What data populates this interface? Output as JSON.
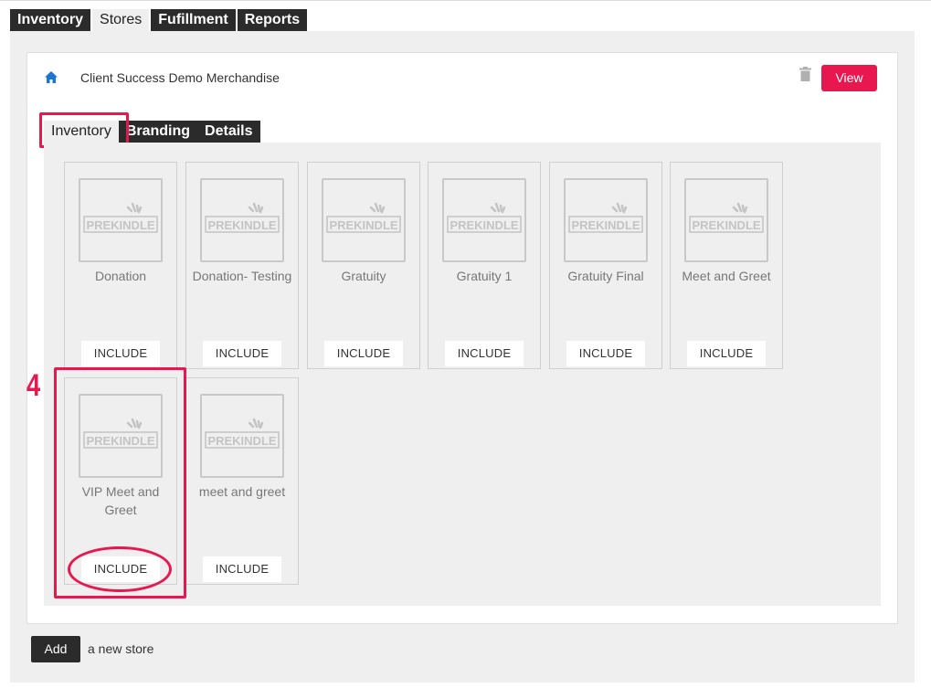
{
  "top_tabs": [
    {
      "label": "Inventory",
      "active": false
    },
    {
      "label": "Stores",
      "active": true
    },
    {
      "label": "Fufillment",
      "active": false
    },
    {
      "label": "Reports",
      "active": false
    }
  ],
  "store": {
    "name": "Client Success Demo Merchandise",
    "view_label": "View",
    "icons": {
      "home": "home-icon",
      "trash": "trash-icon"
    }
  },
  "inner_tabs": [
    {
      "label": "Inventory",
      "active": true
    },
    {
      "label": "Branding",
      "active": false
    },
    {
      "label": "Details",
      "active": false
    }
  ],
  "products": [
    {
      "name": "Donation",
      "button": "INCLUDE"
    },
    {
      "name": "Donation- Testing",
      "button": "INCLUDE"
    },
    {
      "name": "Gratuity",
      "button": "INCLUDE"
    },
    {
      "name": "Gratuity 1",
      "button": "INCLUDE"
    },
    {
      "name": "Gratuity Final",
      "button": "INCLUDE"
    },
    {
      "name": "Meet and Greet",
      "button": "INCLUDE"
    },
    {
      "name": "VIP Meet and Greet",
      "button": "INCLUDE"
    },
    {
      "name": "meet and greet",
      "button": "INCLUDE"
    }
  ],
  "placeholder_logo_text": "PREKINDLE",
  "annotation": {
    "step_number": "4"
  },
  "add_store": {
    "button_label": "Add",
    "text": "a new store"
  },
  "colors": {
    "accent": "#e8174f",
    "dark": "#2b2b2b",
    "panel": "#efefef",
    "link_blue": "#1976d2"
  }
}
